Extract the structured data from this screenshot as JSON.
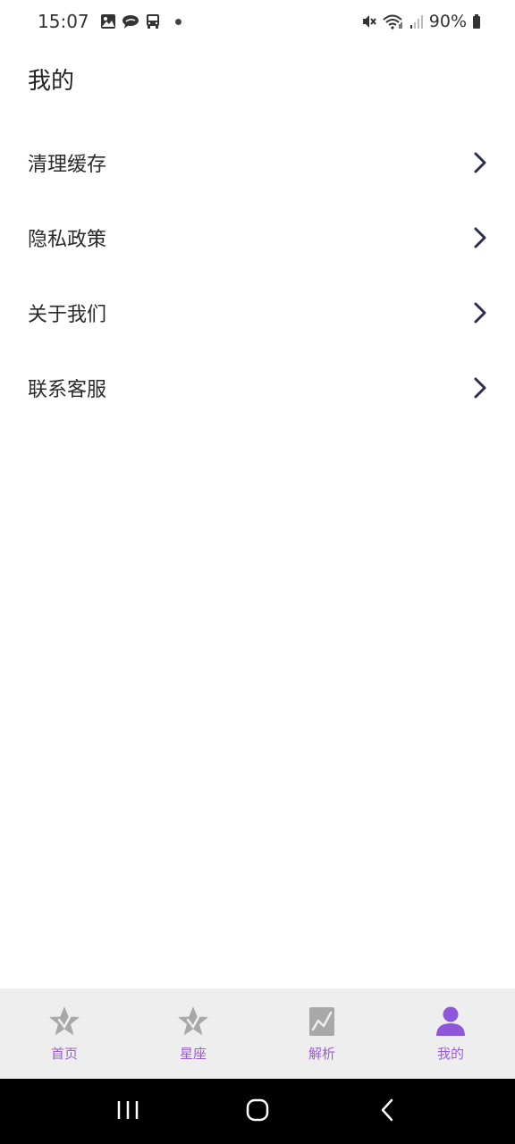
{
  "status_bar": {
    "time": "15:07",
    "battery": "90%",
    "left_icons": [
      "image-icon",
      "chat-bubble-icon",
      "bus-icon",
      "notification-dot"
    ],
    "right_icons": [
      "mute-icon",
      "wifi-icon",
      "signal-icon",
      "battery-icon"
    ]
  },
  "page": {
    "title": "我的"
  },
  "menu": {
    "items": [
      {
        "label": "清理缓存",
        "icon": "chevron-right-icon"
      },
      {
        "label": "隐私政策",
        "icon": "chevron-right-icon"
      },
      {
        "label": "关于我们",
        "icon": "chevron-right-icon"
      },
      {
        "label": "联系客服",
        "icon": "chevron-right-icon"
      }
    ]
  },
  "tab_bar": {
    "tabs": [
      {
        "label": "首页",
        "icon": "star-icon",
        "active": false
      },
      {
        "label": "星座",
        "icon": "star-icon",
        "active": false
      },
      {
        "label": "解析",
        "icon": "chart-icon",
        "active": false
      },
      {
        "label": "我的",
        "icon": "person-icon",
        "active": true
      }
    ],
    "active_color": "#8e56d8",
    "inactive_icon_color": "#a8a8a8",
    "label_color": "#9a5ed6"
  },
  "nav_bar": {
    "buttons": [
      "recent-apps-icon",
      "home-icon",
      "back-icon"
    ]
  },
  "colors": {
    "chevron": "#2b2d52",
    "tab_bar_bg": "#eeeeee",
    "nav_bar_bg": "#000000"
  }
}
